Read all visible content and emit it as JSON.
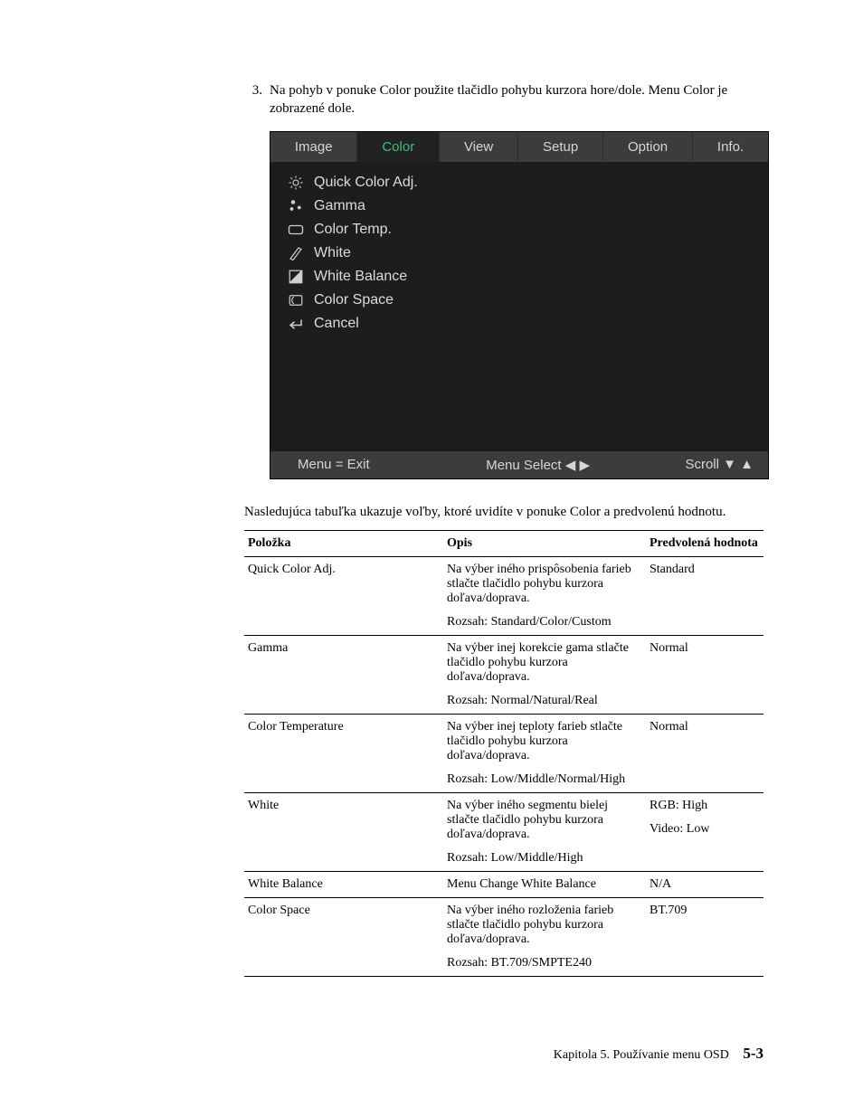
{
  "step": {
    "number": "3.",
    "text": "Na pohyb v ponuke Color použite tlačidlo pohybu kurzora hore/dole. Menu Color je zobrazené dole."
  },
  "osd": {
    "tabs": [
      "Image",
      "Color",
      "View",
      "Setup",
      "Option",
      "Info."
    ],
    "active_tab_index": 1,
    "items": [
      "Quick Color Adj.",
      "Gamma",
      "Color Temp.",
      "White",
      "White Balance",
      "Color Space",
      "Cancel"
    ],
    "footer": {
      "left": "Menu = Exit",
      "center": "Menu Select ◀ ▶",
      "right": "Scroll ▼ ▲"
    }
  },
  "intro": "Nasledujúca tabuľka ukazuje voľby, ktoré uvidíte v ponuke Color a predvolenú hodnotu.",
  "table": {
    "headers": [
      "Položka",
      "Opis",
      "Predvolená hodnota"
    ],
    "rows": [
      {
        "item": "Quick Color Adj.",
        "desc1": "Na výber iného prispôsobenia farieb stlačte tlačidlo pohybu kurzora doľava/doprava.",
        "desc2": "Rozsah: Standard/Color/Custom",
        "default1": "Standard",
        "default2": ""
      },
      {
        "item": "Gamma",
        "desc1": "Na výber inej korekcie gama stlačte tlačidlo pohybu kurzora doľava/doprava.",
        "desc2": "Rozsah: Normal/Natural/Real",
        "default1": "Normal",
        "default2": ""
      },
      {
        "item": "Color Temperature",
        "desc1": "Na výber inej teploty farieb stlačte tlačidlo pohybu kurzora doľava/doprava.",
        "desc2": "Rozsah: Low/Middle/Normal/High",
        "default1": "Normal",
        "default2": ""
      },
      {
        "item": "White",
        "desc1": "Na výber iného segmentu bielej stlačte tlačidlo pohybu kurzora doľava/doprava.",
        "desc2": "Rozsah: Low/Middle/High",
        "default1": "RGB: High",
        "default2": "Video: Low"
      },
      {
        "item": "White Balance",
        "desc1": "Menu Change White Balance",
        "desc2": "",
        "default1": "N/A",
        "default2": ""
      },
      {
        "item": "Color Space",
        "desc1": "Na výber iného rozloženia farieb stlačte tlačidlo pohybu kurzora doľava/doprava.",
        "desc2": "Rozsah: BT.709/SMPTE240",
        "default1": "BT.709",
        "default2": ""
      }
    ]
  },
  "footer": {
    "chapter": "Kapitola 5. Používanie menu OSD",
    "page": "5-3"
  }
}
